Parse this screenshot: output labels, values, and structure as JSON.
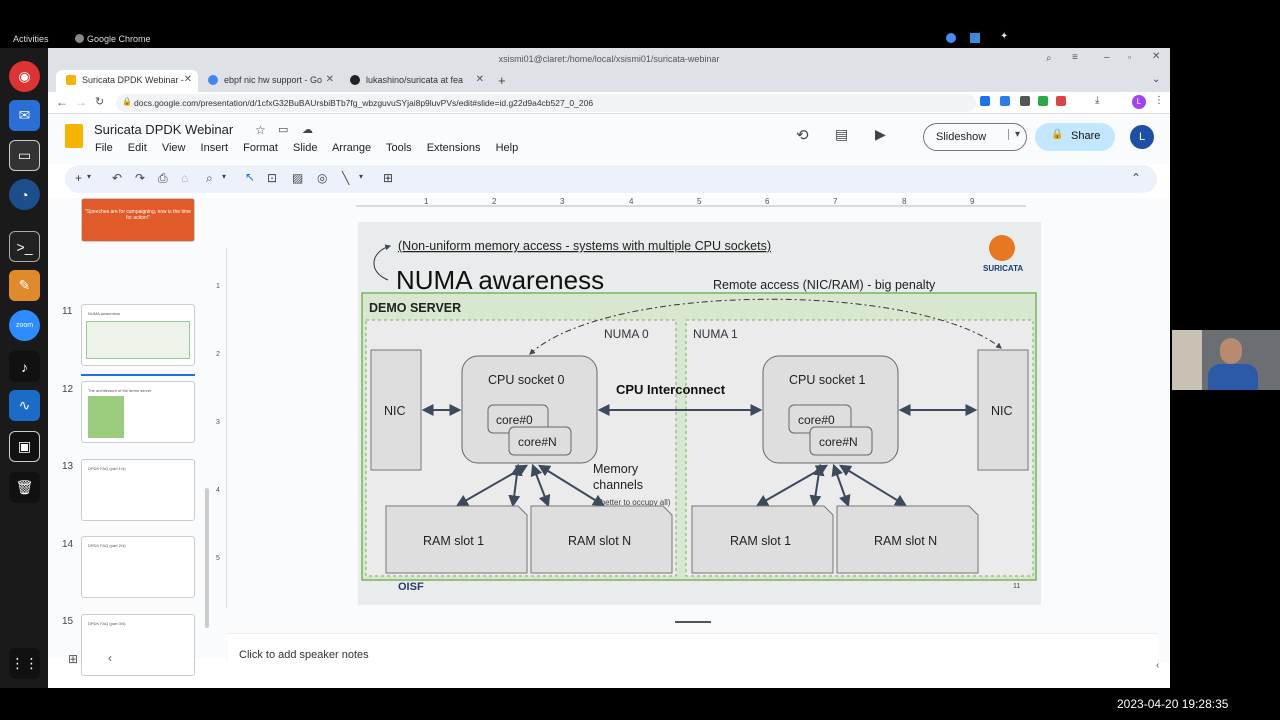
{
  "os": {
    "activities": "Activities",
    "app_name": "Google Chrome",
    "clock": "2023-04-20 19:28:35"
  },
  "window": {
    "title": "xsismi01@claret:/home/local/xsismi01/suricata-webinar"
  },
  "tabs": [
    {
      "label": "Suricata DPDK Webinar -"
    },
    {
      "label": "ebpf nic hw support - Go"
    },
    {
      "label": "lukashino/suricata at fea"
    }
  ],
  "address_bar": {
    "url": "docs.google.com/presentation/d/1cfxG32BuBAUrsbiBTb7fg_wbzguvuSYjai8p9luvPVs/edit#slide=id.g22d9a4cb527_0_206"
  },
  "docs": {
    "title": "Suricata DPDK Webinar",
    "menu": [
      "File",
      "Edit",
      "View",
      "Insert",
      "Format",
      "Slide",
      "Arrange",
      "Tools",
      "Extensions",
      "Help"
    ],
    "slideshow_label": "Slideshow",
    "share_label": "Share",
    "avatar_letter": "L",
    "speaker_notes_placeholder": "Click to add speaker notes"
  },
  "ruler": [
    "1",
    "2",
    "3",
    "4",
    "5",
    "6",
    "7",
    "8",
    "9"
  ],
  "vruler": [
    "1",
    "2",
    "3",
    "4",
    "5"
  ],
  "filmstrip": {
    "top_partial_text": "\"Speeches are for campaigning, now is the time for action!\"",
    "slides": [
      {
        "number": "11",
        "title": "NUMA awareness"
      },
      {
        "number": "12",
        "title": "The architecture of the demo server"
      },
      {
        "number": "13",
        "title": "DPDK FAQ (part 1/4)"
      },
      {
        "number": "14",
        "title": "DPDK FAQ (part 2/4)"
      },
      {
        "number": "15",
        "title": "DPDK FAQ (part 3/4)"
      }
    ]
  },
  "slide": {
    "subtitle": "(Non-uniform memory access - systems with multiple CPU sockets)",
    "title": "NUMA awareness",
    "remote_note": "Remote access (NIC/RAM) - big penalty",
    "logo_text": "SURICATA",
    "server_label": "DEMO SERVER",
    "numa0": "NUMA 0",
    "numa1": "NUMA 1",
    "nic_left": "NIC",
    "nic_right": "NIC",
    "cpu0": "CPU socket 0",
    "cpu1": "CPU socket 1",
    "core0": "core#0",
    "coreN": "core#N",
    "interconnect": "CPU Interconnect",
    "memory_line1": "Memory",
    "memory_line2": "channels",
    "memory_note": "(better to occupy all)",
    "ram1": "RAM slot 1",
    "ramN": "RAM slot N",
    "oisf": "OISF",
    "page_number": "11"
  }
}
